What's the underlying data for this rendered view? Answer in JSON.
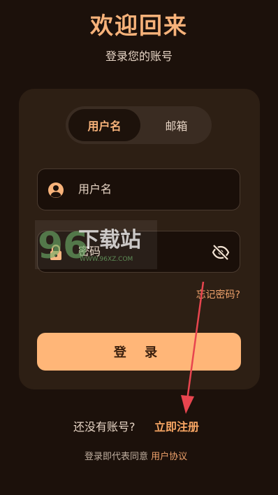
{
  "header": {
    "title": "欢迎回来",
    "subtitle": "登录您的账号"
  },
  "tabs": [
    {
      "label": "用户名",
      "selected": true
    },
    {
      "label": "邮箱",
      "selected": false
    }
  ],
  "form": {
    "username_placeholder": "用户名",
    "password_placeholder": "密码",
    "forgot_label": "忘记密码?",
    "login_label": "登 录"
  },
  "footer": {
    "no_account": "还没有账号?",
    "register": "立即注册",
    "terms_prefix": "登录即代表同意",
    "terms_link": "用户协议"
  },
  "watermark": {
    "text": "下载站",
    "url": "WWW.96XZ.COM",
    "logo": "96"
  },
  "colors": {
    "background": "#1c110b",
    "card": "#2d1f14",
    "accent": "#f7b27a",
    "button": "#ffb678",
    "annotation_arrow": "#e8454f"
  }
}
